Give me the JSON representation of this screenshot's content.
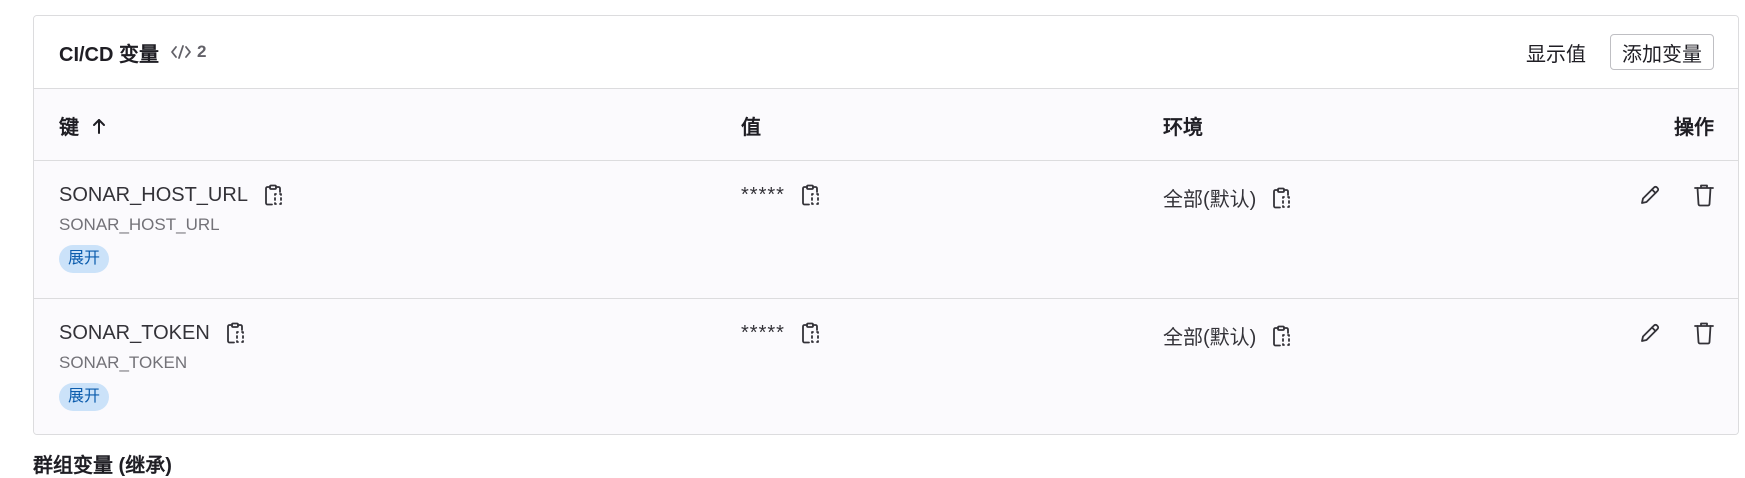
{
  "card": {
    "title": "CI/CD 变量",
    "count": "2",
    "reveal_label": "显示值",
    "add_label": "添加变量"
  },
  "table": {
    "headers": {
      "key": "键",
      "value": "值",
      "environment": "环境",
      "actions": "操作"
    },
    "rows": [
      {
        "key": "SONAR_HOST_URL",
        "description": "SONAR_HOST_URL",
        "badge": "展开",
        "value": "*****",
        "environment": "全部(默认)"
      },
      {
        "key": "SONAR_TOKEN",
        "description": "SONAR_TOKEN",
        "badge": "展开",
        "value": "*****",
        "environment": "全部(默认)"
      }
    ]
  },
  "below_title": "群组变量 (继承)",
  "icons": {
    "count": "code-icon",
    "sort": "arrow-up-icon",
    "copy": "copy-to-clipboard-icon",
    "edit": "pencil-icon",
    "delete": "trash-icon"
  },
  "colors": {
    "badge_bg": "#cbe2f9",
    "badge_text": "#0b5cad",
    "border": "#dcdcde",
    "row_bg": "#fbfafd"
  }
}
